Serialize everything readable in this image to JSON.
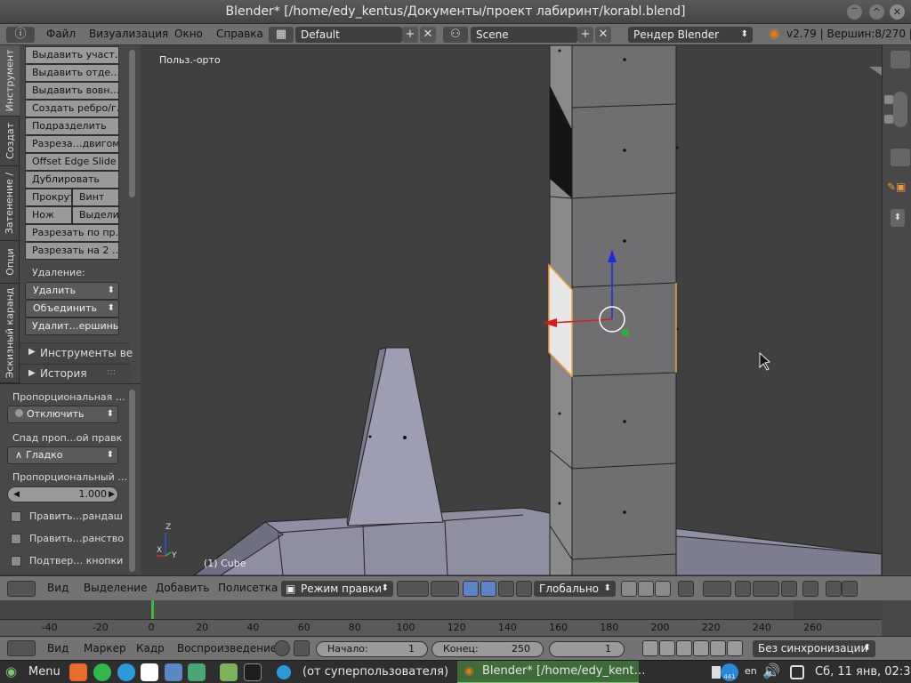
{
  "window": {
    "title": "Blender* [/home/edy_kentus/Документы/проект лабиринт/korabl.blend]"
  },
  "info": {
    "menus": [
      "Файл",
      "Визуализация",
      "Окно",
      "Справка"
    ],
    "layout": "Default",
    "scene": "Scene",
    "engine": "Рендер Blender",
    "stats": "v2.79 | Вершин:8/270 | Гр"
  },
  "tabs": [
    "Инструмент",
    "Создат",
    "Затенение /",
    "Опци",
    "Эскизный каранд"
  ],
  "tools": {
    "buttons": [
      "Выдавить участ…",
      "Выдавить отде…",
      "Выдавить вовн…",
      "Создать ребро/г…",
      "Подразделить",
      "Разреза…двигом",
      "Offset Edge Slide",
      "Дублировать"
    ],
    "pair1": [
      "Прокрут",
      "Винт"
    ],
    "pair2": [
      "Нож",
      "Выдели"
    ],
    "buttons2": [
      "Разрезать по пр…",
      "Разрезать на 2 …"
    ],
    "delete_label": "Удаление:",
    "delete": "Удалить",
    "merge": "Объединить",
    "remove_verts": "Удалит…ершины",
    "panel_tools": "Инструменты ве",
    "panel_history": "История"
  },
  "props": {
    "proportional_label": "Пропорциональная …",
    "proportional_value": "Отключить",
    "falloff_label": "Спад проп…ой правк",
    "falloff_value": "Гладко",
    "size_label": "Пропорциональный …",
    "size_value": "1.000",
    "check1": "Править…рандаш",
    "check2": "Править…ранство",
    "check3": "Подтвер… кнопки"
  },
  "viewport": {
    "view_name": "Польз.-орто",
    "object_label": "(1) Cube",
    "axis_z": "Z",
    "axis_x": "X",
    "axis_y": "Y"
  },
  "header3d": {
    "view": "Вид",
    "select": "Выделение",
    "add": "Добавить",
    "mesh": "Полисетка",
    "mode": "Режим правки",
    "orientation": "Глобально"
  },
  "timeline": {
    "ticks": [
      "-40",
      "-20",
      "0",
      "20",
      "40",
      "60",
      "80",
      "100",
      "120",
      "140",
      "160",
      "180",
      "200",
      "220",
      "240",
      "260"
    ],
    "current_frame": 1
  },
  "timebar": {
    "view": "Вид",
    "marker": "Маркер",
    "frame": "Кадр",
    "playback": "Воспроизведение",
    "start_label": "Начало:",
    "start_value": "1",
    "end_label": "Конец:",
    "end_value": "250",
    "current": "1",
    "sync": "Без синхронизации"
  },
  "taskbar": {
    "menu": "Menu",
    "task1": "(от суперпользователя)",
    "task2": "Blender* [/home/edy_kent…",
    "badge": "441",
    "lang": "en",
    "clock": "Сб, 11 янв, 02:33"
  },
  "colors": {
    "selected_face": "#e8e8e8",
    "selection_edge": "#f2a33a",
    "accent_green": "#2c8a3a"
  }
}
